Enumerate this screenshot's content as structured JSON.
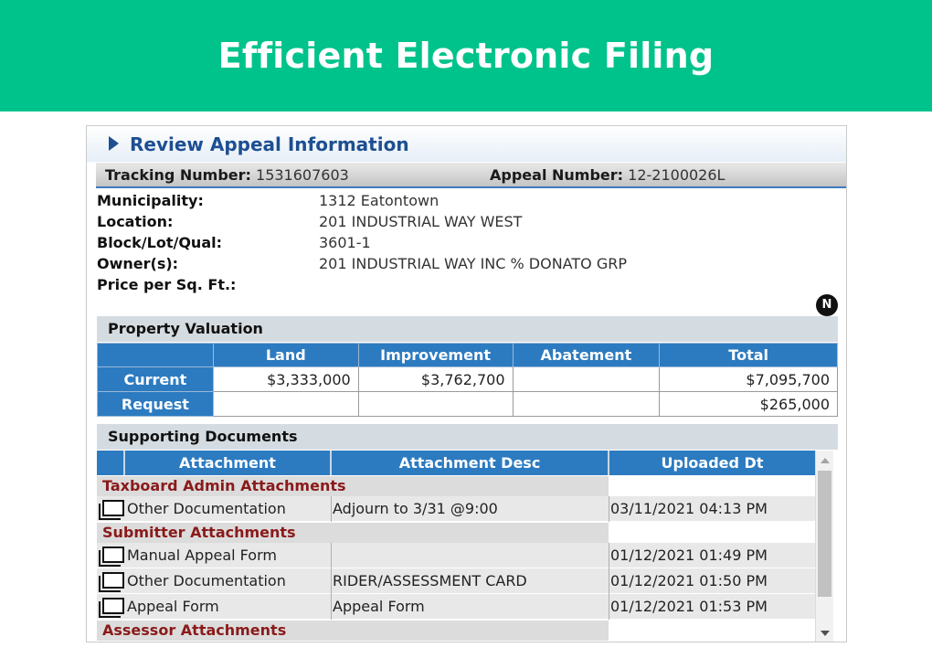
{
  "banner": {
    "title": "Efficient Electronic Filing"
  },
  "panel": {
    "title": "Review Appeal Information",
    "tracking_label": "Tracking Number:",
    "tracking_value": "1531607603",
    "appeal_label": "Appeal Number:",
    "appeal_value": "12-2100026L"
  },
  "info": [
    {
      "label": "Municipality:",
      "value": "1312 Eatontown"
    },
    {
      "label": "Location:",
      "value": "201 INDUSTRIAL WAY WEST"
    },
    {
      "label": "Block/Lot/Qual:",
      "value": "3601-1"
    },
    {
      "label": "Owner(s):",
      "value": "201 INDUSTRIAL WAY INC % DONATO GRP"
    },
    {
      "label": "Price per Sq. Ft.:",
      "value": ""
    }
  ],
  "badge": "N",
  "valuation": {
    "title": "Property Valuation",
    "columns": [
      "Land",
      "Improvement",
      "Abatement",
      "Total"
    ],
    "rows": [
      {
        "label": "Current",
        "cells": [
          "$3,333,000",
          "$3,762,700",
          "",
          "$7,095,700"
        ]
      },
      {
        "label": "Request",
        "cells": [
          "",
          "",
          "",
          "$265,000"
        ]
      }
    ]
  },
  "documents": {
    "title": "Supporting Documents",
    "columns": [
      "Attachment",
      "Attachment Desc",
      "Uploaded Dt"
    ],
    "groups": [
      {
        "name": "Taxboard Admin Attachments",
        "rows": [
          {
            "attachment": "Other Documentation",
            "desc": "Adjourn to 3/31 @9:00",
            "date": "03/11/2021 04:13 PM"
          }
        ]
      },
      {
        "name": "Submitter Attachments",
        "rows": [
          {
            "attachment": "Manual Appeal Form",
            "desc": "",
            "date": "01/12/2021 01:49 PM"
          },
          {
            "attachment": "Other Documentation",
            "desc": "RIDER/ASSESSMENT CARD",
            "date": "01/12/2021 01:50 PM"
          },
          {
            "attachment": "Appeal Form",
            "desc": "Appeal Form",
            "date": "01/12/2021 01:53 PM"
          }
        ]
      },
      {
        "name": "Assessor Attachments",
        "rows": []
      }
    ]
  },
  "colors": {
    "banner": "#00c38b",
    "header_blue": "#2c7bc0",
    "title_blue": "#1d4f91",
    "group_red": "#8a1a1a"
  }
}
